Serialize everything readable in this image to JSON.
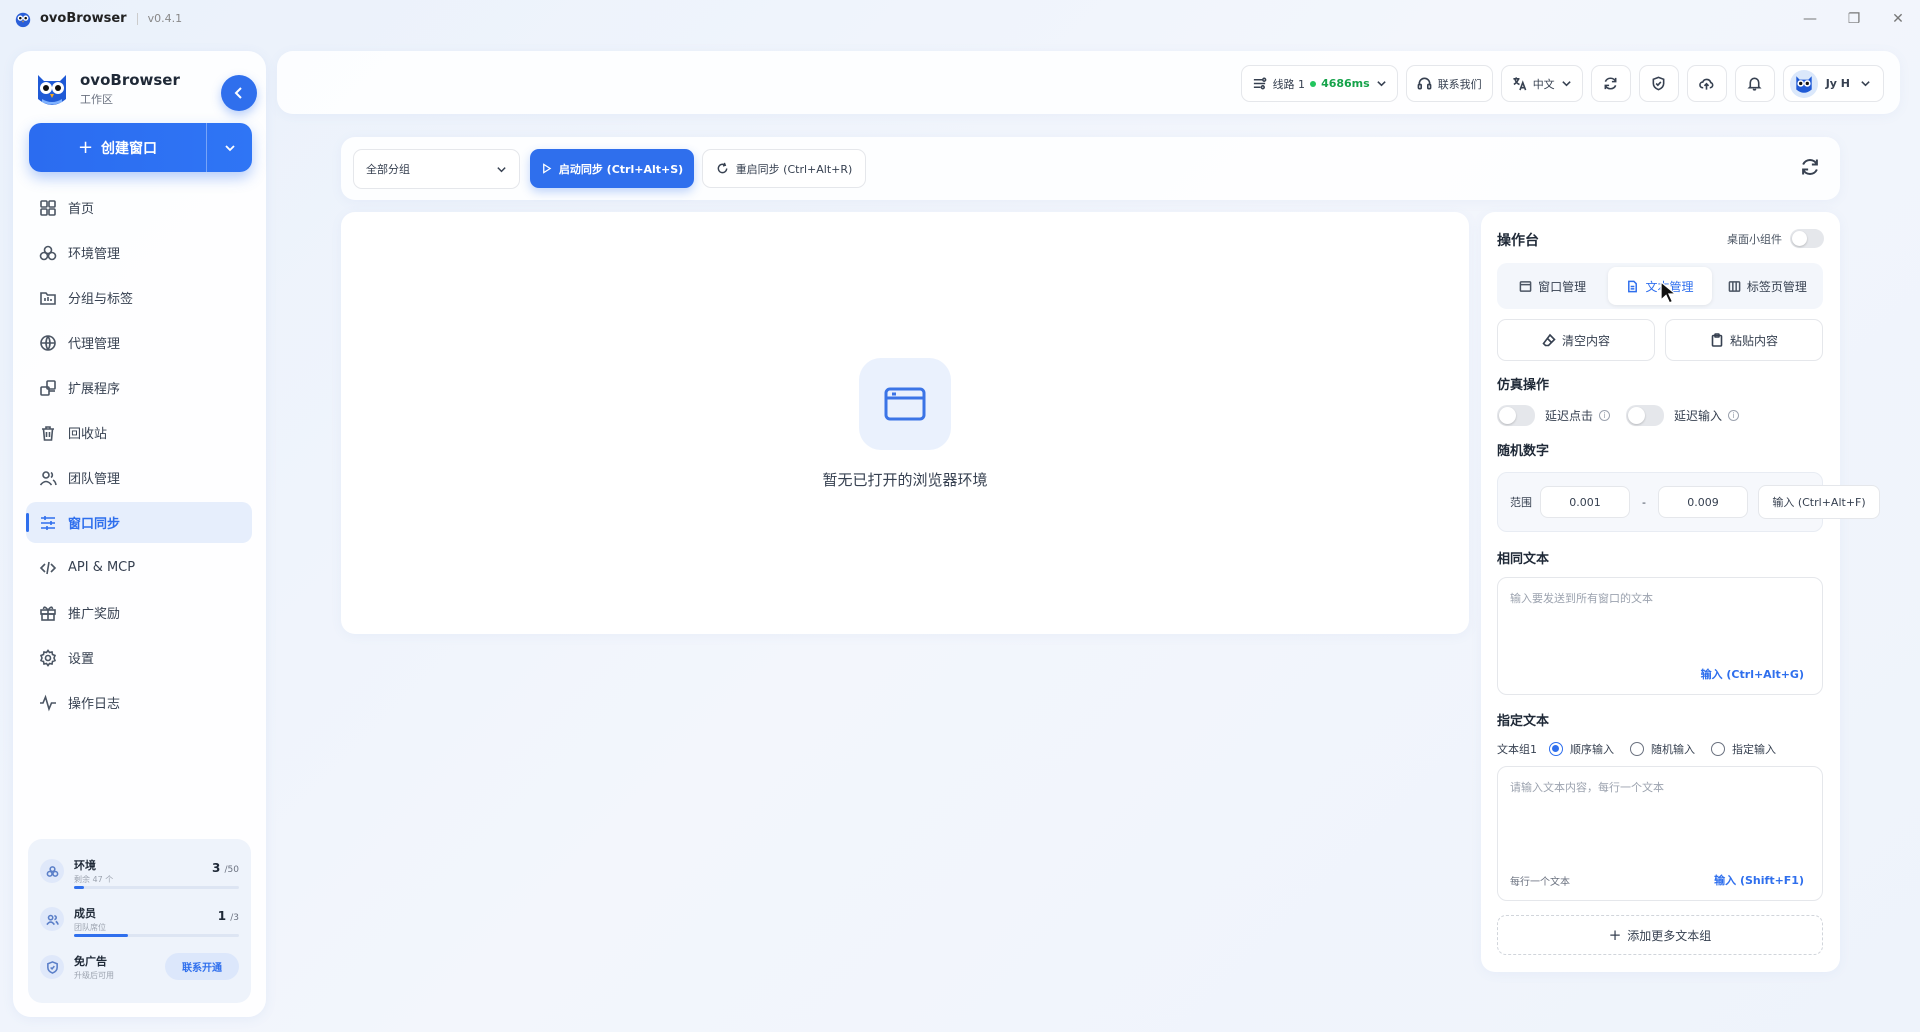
{
  "titlebar": {
    "app_name": "ovoBrowser",
    "version": "v0.4.1"
  },
  "sidebar": {
    "brand_name": "ovoBrowser",
    "brand_sub": "工作区",
    "create_label": "创建窗口",
    "items": [
      {
        "label": "首页",
        "icon": "home-icon"
      },
      {
        "label": "环境管理",
        "icon": "environments-icon"
      },
      {
        "label": "分组与标签",
        "icon": "folder-icon"
      },
      {
        "label": "代理管理",
        "icon": "globe-icon"
      },
      {
        "label": "扩展程序",
        "icon": "puzzle-icon"
      },
      {
        "label": "回收站",
        "icon": "trash-icon"
      },
      {
        "label": "团队管理",
        "icon": "team-icon"
      },
      {
        "label": "窗口同步",
        "icon": "sliders-icon",
        "active": true
      },
      {
        "label": "API & MCP",
        "icon": "code-icon"
      },
      {
        "label": "推广奖励",
        "icon": "gift-icon"
      },
      {
        "label": "设置",
        "icon": "gear-icon"
      },
      {
        "label": "操作日志",
        "icon": "activity-icon"
      }
    ],
    "quota": {
      "env_title": "环境",
      "env_sub": "剩余 47 个",
      "env_used": "3",
      "env_total": "/50",
      "env_fraction": 0.06,
      "member_title": "成员",
      "member_sub": "团队席位",
      "member_used": "1",
      "member_total": "/3",
      "member_fraction": 0.33,
      "ad_title": "免广告",
      "ad_sub": "升级后可用",
      "ad_button": "联系开通"
    }
  },
  "topbar": {
    "line_label": "线路 1",
    "latency": "4686ms",
    "contact": "联系我们",
    "language": "中文",
    "user": "Jy H"
  },
  "sync": {
    "group_select": "全部分组",
    "start_label": "启动同步 (Ctrl+Alt+S)",
    "restart_label": "重启同步 (Ctrl+Alt+R)",
    "empty_text": "暂无已打开的浏览器环境"
  },
  "console": {
    "title": "操作台",
    "widget_label": "桌面小组件",
    "tabs": [
      "窗口管理",
      "文本管理",
      "标签页管理"
    ],
    "active_tab": 1,
    "clear_label": "清空内容",
    "paste_label": "粘贴内容",
    "sim_title": "仿真操作",
    "delay_click": "延迟点击",
    "delay_input": "延迟输入",
    "random_title": "随机数字",
    "range_label": "范围",
    "range_min": "0.001",
    "range_max": "0.009",
    "range_button": "输入 (Ctrl+Alt+F)",
    "same_title": "相同文本",
    "same_placeholder": "输入要发送到所有窗口的文本",
    "same_button": "输入 (Ctrl+Alt+G)",
    "assigned_title": "指定文本",
    "group_label": "文本组1",
    "radio_seq": "顺序输入",
    "radio_rand": "随机输入",
    "radio_assign": "指定输入",
    "assigned_placeholder": "请输入文本内容，每行一个文本",
    "assigned_hint": "每行一个文本",
    "assigned_button": "输入 (Shift+F1)",
    "add_more": "添加更多文本组"
  }
}
